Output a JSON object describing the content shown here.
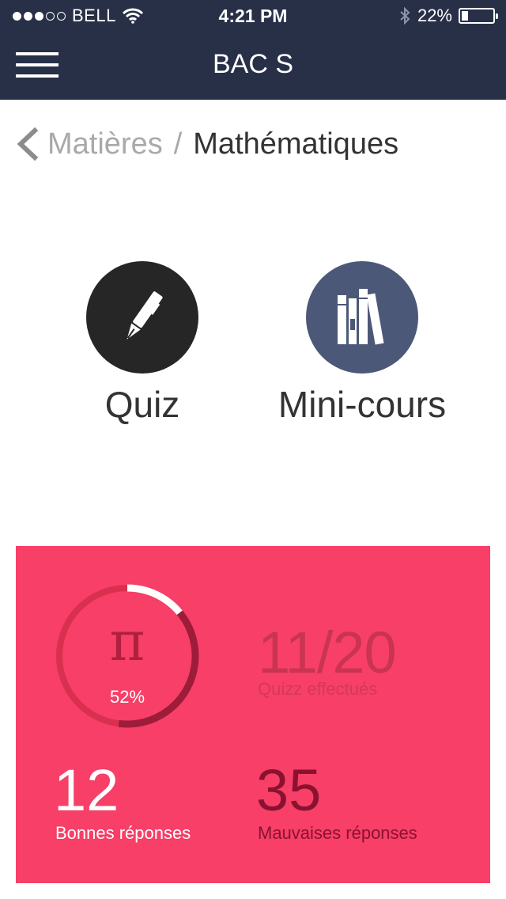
{
  "status_bar": {
    "carrier": "BELL",
    "time": "4:21 PM",
    "battery": "22%",
    "signal_bars": 3,
    "signal_total": 5
  },
  "header": {
    "title": "BAC S",
    "menu_icon": "hamburger-menu-icon"
  },
  "breadcrumb": {
    "back_icon": "chevron-left-icon",
    "parent": "Matières",
    "separator": "/",
    "current": "Mathématiques"
  },
  "tiles": [
    {
      "label": "Quiz",
      "icon": "pen-icon",
      "color": "#262626"
    },
    {
      "label": "Mini-cours",
      "icon": "books-icon",
      "color": "#4c5877"
    }
  ],
  "stats": {
    "background": "#f73f67",
    "progress_symbol": "π",
    "progress_percent": "52%",
    "progress_value": 0.52,
    "quizzes_done": "11/20",
    "quizzes_done_label": "Quizz effectués",
    "correct_count": "12",
    "correct_label": "Bonnes réponses",
    "wrong_count": "35",
    "wrong_label": "Mauvaises réponses"
  }
}
